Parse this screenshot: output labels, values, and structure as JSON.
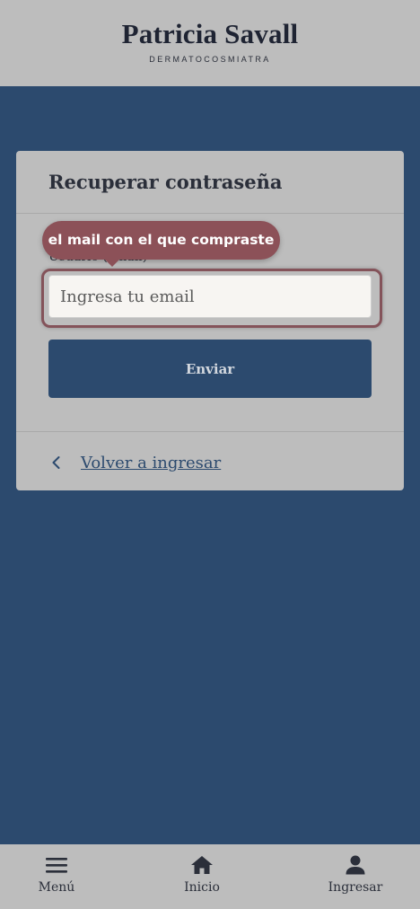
{
  "header": {
    "brand_name": "Patricia Savall",
    "brand_subtitle": "DERMATOCOSMIATRA"
  },
  "card": {
    "title": "Recuperar contraseña",
    "field_label": "Usuario (email)",
    "tooltip": "el mail con el que compraste",
    "email_placeholder": "Ingresa tu email",
    "email_value": "",
    "submit_label": "Enviar",
    "back_link": "Volver a ingresar"
  },
  "bottom_nav": {
    "items": [
      {
        "label": "Menú",
        "icon": "menu-icon"
      },
      {
        "label": "Inicio",
        "icon": "home-icon"
      },
      {
        "label": "Ingresar",
        "icon": "user-icon"
      }
    ]
  },
  "colors": {
    "primary": "#2c4a6e",
    "surface": "#bdbdbd",
    "tooltip": "#8c5158"
  }
}
